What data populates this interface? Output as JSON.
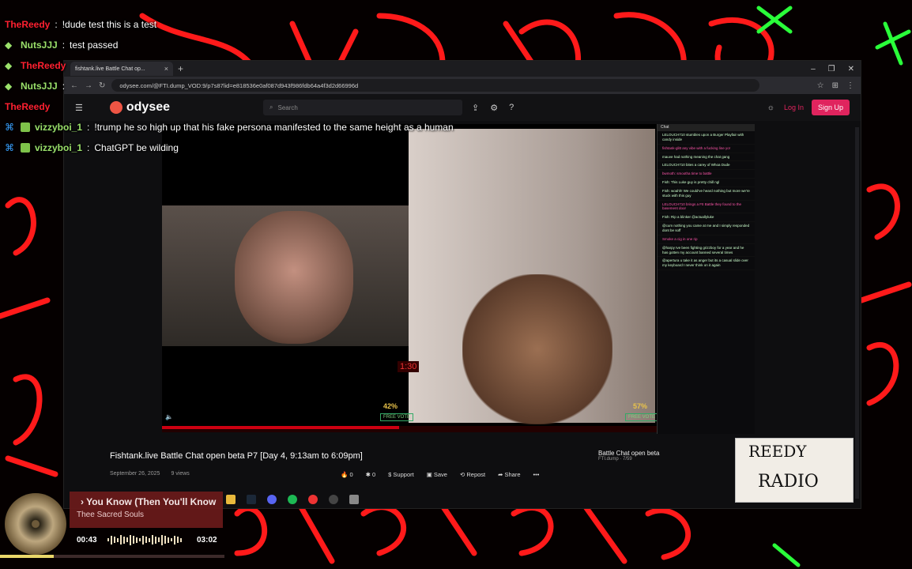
{
  "background": {
    "accent": "#ff1a1a",
    "green": "#2aff3a"
  },
  "chat_overlay": [
    {
      "user": "TheReedy",
      "message": "!dude test this is a test",
      "user_color": "#ff2030"
    },
    {
      "user": "NutsJJJ",
      "message": "test passed",
      "user_color": "#9be06a"
    },
    {
      "user": "TheReedy",
      "message": "",
      "user_color": "#ff2030"
    },
    {
      "user": "NutsJJJ",
      "message": "",
      "user_color": "#9be06a"
    },
    {
      "user": "TheReedy",
      "message": "",
      "user_color": "#ff2030"
    },
    {
      "user": "vizzyboi_1",
      "message": "!trump he so high up that his fake persona manifested to the same height as a human",
      "user_color": "#9be06a"
    },
    {
      "user": "vizzyboi_1",
      "message": "ChatGPT be wilding",
      "user_color": "#9be06a"
    }
  ],
  "browser": {
    "tab_title": "fishtank.live Battle Chat op...",
    "url": "odysee.com/@FTI.dump_VOD:9/p7s87lid=e818536e0af087d943f986fdb64a4f3d2d66996d",
    "site_name": "odysee",
    "search_placeholder": "Search",
    "login_label": "Log In",
    "signup_label": "Sign Up"
  },
  "video": {
    "title": "Fishtank.live Battle Chat open beta P7 [Day 4, 9:13am to 6:09pm]",
    "date": "September 26, 2025",
    "views": "9 views",
    "timer": "1:30",
    "left_pct": "42%",
    "right_pct": "57%",
    "free_vote": "FREE VOTE",
    "progress": 0.4,
    "actions": [
      {
        "icon": "fire-icon",
        "label": "0"
      },
      {
        "icon": "slime-icon",
        "label": "0"
      },
      {
        "icon": "dollar-icon",
        "label": "Support"
      },
      {
        "icon": "save-icon",
        "label": "Save"
      },
      {
        "icon": "repost-icon",
        "label": "Repost"
      },
      {
        "icon": "share-icon",
        "label": "Share"
      }
    ]
  },
  "stream_chat": {
    "header": "Chat",
    "messages": [
      "LELOUCH710 stumbles upon a Burger Playfair with candy inside",
      "fishtank-glitt any vibe with a fucking line yo!",
      "mauve had nothing meaning the chat gang",
      "LELOUCH710 bites a carey of Whoa Dude",
      "bwmoth: smootha time to battle",
      "Fish: This Luke guy is pretty chill ngl",
      "Fish: woahh! We could've heard nothing but more we're stuck with this guy",
      "LELOUCH710 brings a FtI Battle they found to the basement door",
      "Fish: Rip a blinker @actuallyluke",
      "@cum nothing you came at me and I simply responded dont be soff",
      "Smoke a cig in one rip",
      "@harpy Ive been fighting grizzboy for a year and he has gotten my account banned several times",
      "@apertura u take it as anger but its a casual slide over my keyboard I never think on it again"
    ]
  },
  "playlist": {
    "title": "Battle Chat open beta",
    "subtitle": "FTI.dump · 7/59"
  },
  "now_playing": {
    "song": "› You Know (Then You'll Know",
    "artist": "Thee Sacred Souls",
    "elapsed": "00:43",
    "total": "03:02",
    "progress": 0.24
  },
  "reedy_logo": {
    "line1": "REEDY",
    "line2": "RADIO"
  }
}
